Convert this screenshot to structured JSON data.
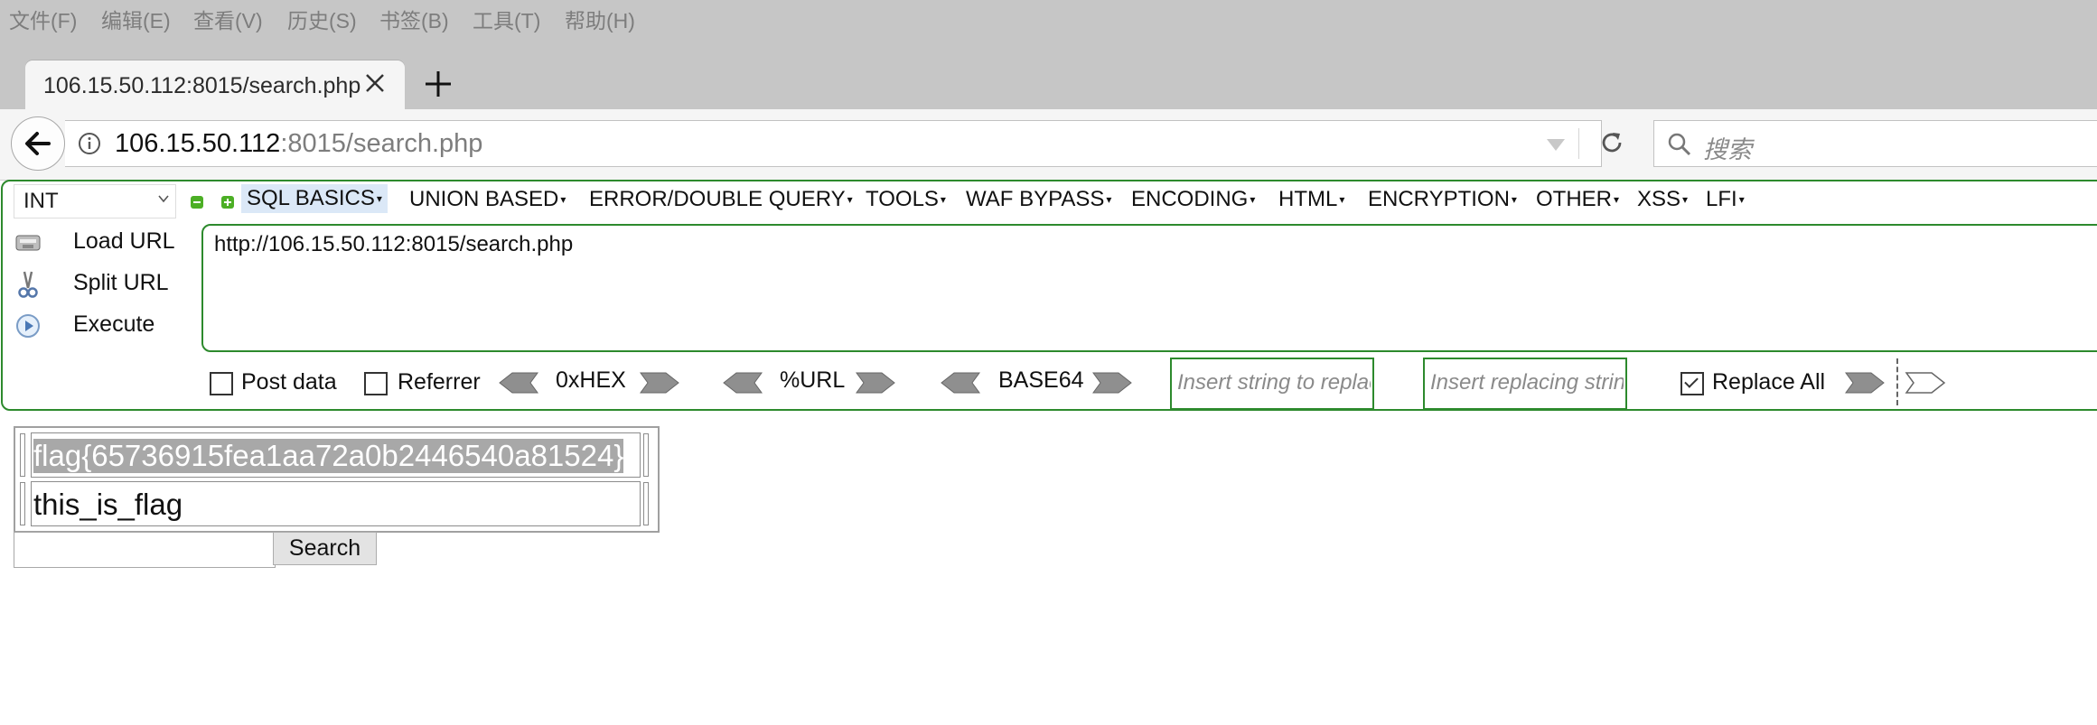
{
  "menubar": [
    "文件(F)",
    "编辑(E)",
    "查看(V)",
    "历史(S)",
    "书签(B)",
    "工具(T)",
    "帮助(H)"
  ],
  "tab": {
    "title": "106.15.50.112:8015/search.php"
  },
  "address": {
    "host": "106.15.50.112",
    "rest": ":8015/search.php"
  },
  "search_bar": {
    "placeholder": "搜索"
  },
  "hackbar": {
    "type_select": "INT",
    "menus": [
      "SQL BASICS",
      "UNION BASED",
      "ERROR/DOUBLE QUERY",
      "TOOLS",
      "WAF BYPASS",
      "ENCODING",
      "HTML",
      "ENCRYPTION",
      "OTHER",
      "XSS",
      "LFI"
    ],
    "side_buttons": [
      "Load URL",
      "Split URL",
      "Execute"
    ],
    "url_value": "http://106.15.50.112:8015/search.php",
    "post_data": "Post data",
    "referrer": "Referrer",
    "hex": "0xHEX",
    "urlenc": "%URL",
    "base64": "BASE64",
    "replace_placeholder": "Insert string to replace",
    "replacing_placeholder": "Insert replacing string",
    "replace_all": "Replace All",
    "replace_all_checked": true
  },
  "page": {
    "rows": [
      "flag{65736915fea1aa72a0b2446540a81524}",
      "this_is_flag"
    ],
    "search_button": "Search",
    "search_value": ""
  }
}
